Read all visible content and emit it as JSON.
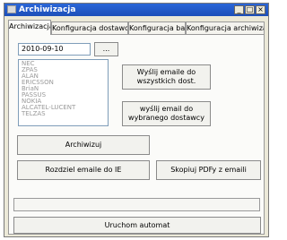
{
  "window": {
    "title": "Archiwizacja",
    "controls": {
      "minimize": "_",
      "maximize": "□",
      "close": "×"
    }
  },
  "tabs": [
    "Archiwizacja",
    "Konfiguracja dostawców",
    "Konfiguracja baz",
    "Konfiguracja archiwizacji"
  ],
  "date_field": {
    "value": "2010-09-10"
  },
  "browse_button": "...",
  "suppliers": [
    "NEC",
    "ZPAS",
    "ALAN",
    "ERICSSON",
    "BriaN",
    "PASSUS",
    "NOKIA",
    "ALCATEL-LUCENT",
    "TELZAS"
  ],
  "buttons": {
    "send_all": "Wyślij emaile do wszystkich dost.",
    "send_selected": "wyślij email do wybranego dostawcy",
    "archive": "Archiwizuj",
    "split_emails": "Rozdziel emaile do IE",
    "copy_pdfs": "Skopiuj PDFy z emaili",
    "run_automat": "Uruchom automat"
  }
}
